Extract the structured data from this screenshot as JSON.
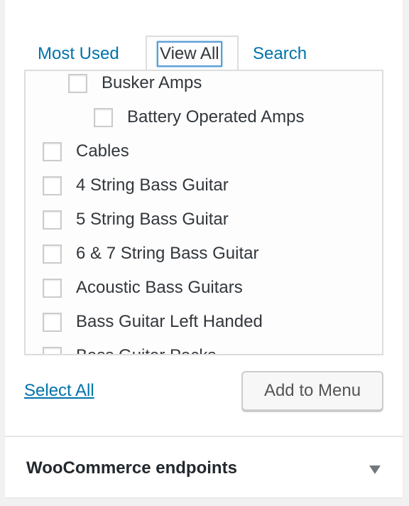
{
  "tabs": {
    "most_used": "Most Used",
    "view_all": "View All",
    "search": "Search"
  },
  "items": [
    {
      "label": "Busker Amps",
      "checked": false,
      "level": 1
    },
    {
      "label": "Battery Operated Amps",
      "checked": false,
      "level": 2
    },
    {
      "label": "Cables",
      "checked": false,
      "level": 0
    },
    {
      "label": "4 String Bass Guitar",
      "checked": false,
      "level": 0
    },
    {
      "label": "5 String Bass Guitar",
      "checked": false,
      "level": 0
    },
    {
      "label": "6 & 7 String Bass Guitar",
      "checked": false,
      "level": 0
    },
    {
      "label": "Acoustic Bass Guitars",
      "checked": false,
      "level": 0
    },
    {
      "label": "Bass Guitar Left Handed",
      "checked": false,
      "level": 0
    },
    {
      "label": "Bass Guitar Packs",
      "checked": false,
      "level": 0
    }
  ],
  "actions": {
    "select_all": "Select All",
    "add_to_menu": "Add to Menu"
  },
  "section": {
    "title": "WooCommerce endpoints",
    "icon": "triangle-down-icon"
  },
  "colors": {
    "link": "#0073aa",
    "focus": "#5b9dd9"
  }
}
